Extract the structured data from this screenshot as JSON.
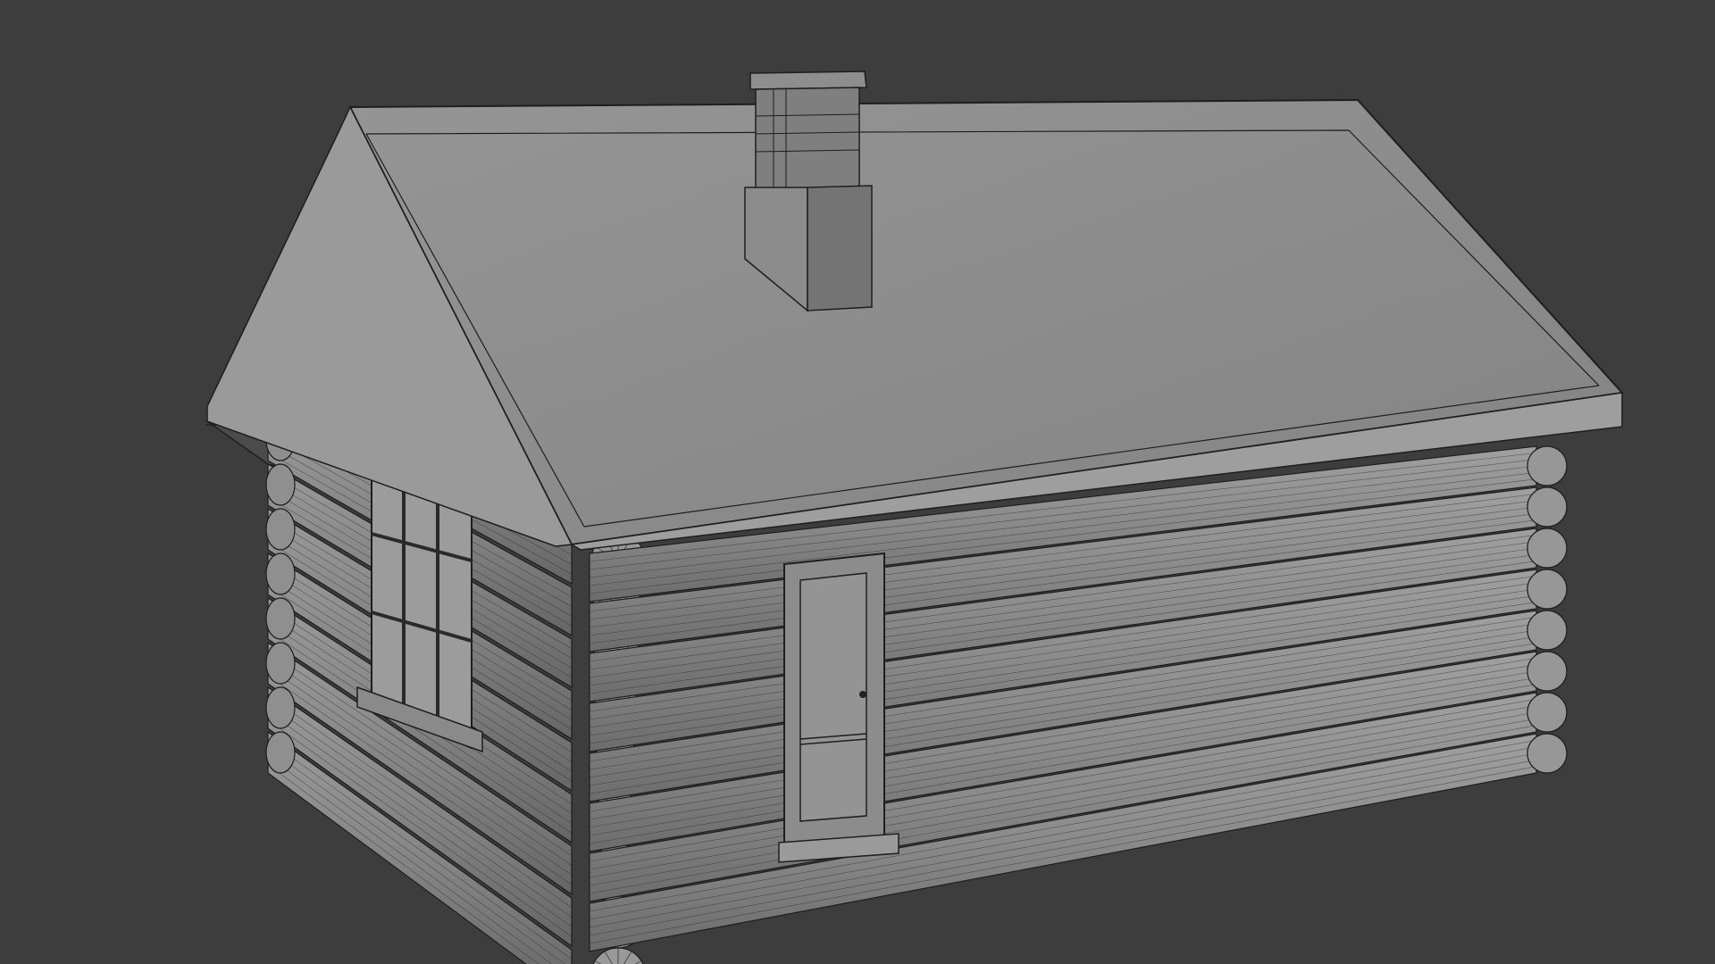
{
  "viewport": {
    "background": "#3d3d3d",
    "model": "log-cabin"
  },
  "colors": {
    "wire": "#1e1e1e",
    "roof_top": "#8a8a8a",
    "roof_edge": "#9a9a9a",
    "log_front": "#8c8c8c",
    "log_side": "#7e7e7e",
    "log_end": "#969696",
    "door": "#8e8e8e",
    "window_frame": "#6e6e6e",
    "window_glass": "#9b9b9b",
    "gable_dark": "#4a4a4a",
    "chimney": "#7d7d7d"
  },
  "icons": {
    "door_handle": "door-handle-icon"
  }
}
